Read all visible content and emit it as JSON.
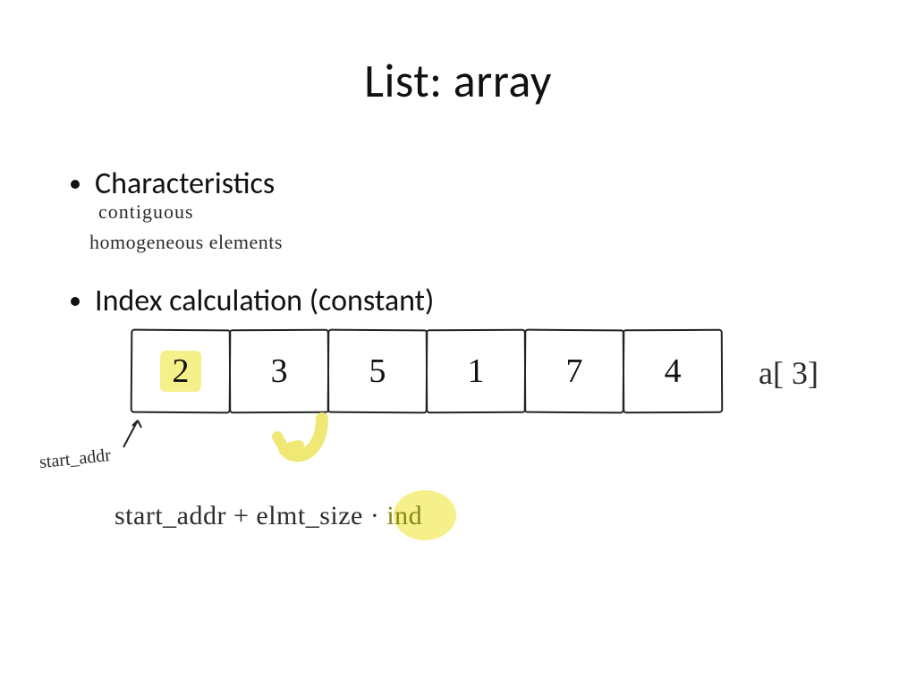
{
  "title": "List: array",
  "bullets": {
    "b1": "Characteristics",
    "b2": "Index calculation (constant)"
  },
  "handwritten": {
    "contiguous": "contiguous",
    "homogeneous": "homogeneous elements",
    "start_addr_label": "start_addr",
    "formula_part1": "start_addr + elmt_size ",
    "formula_dot": "·",
    "formula_ind": " ind",
    "a_index": "a[ 3]"
  },
  "array_cells": {
    "c0": "2",
    "c1": "3",
    "c2": "5",
    "c3": "1",
    "c4": "7",
    "c5": "4"
  }
}
